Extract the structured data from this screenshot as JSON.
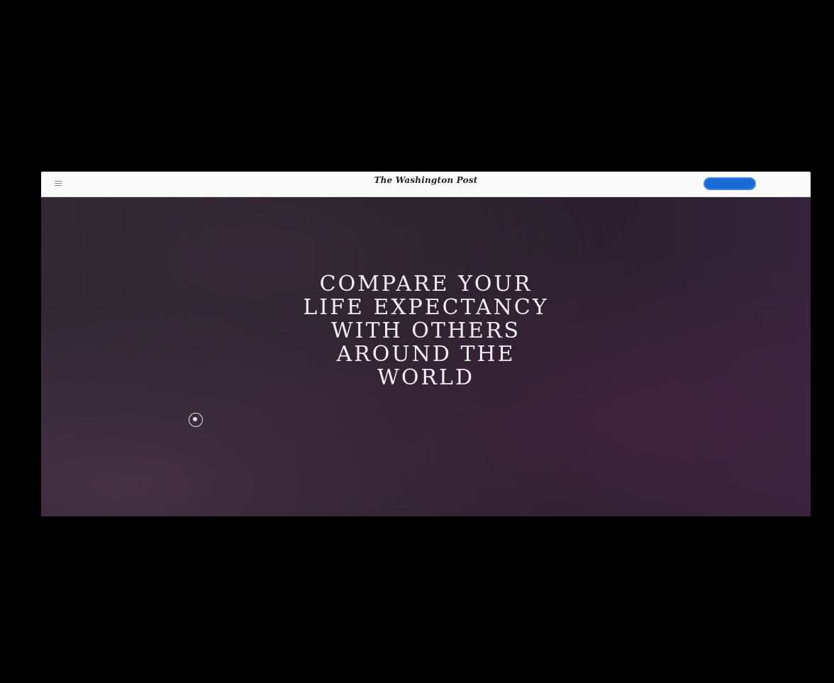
{
  "header": {
    "logo_text": "The Washington Post",
    "logo_tagline": "",
    "subscribe_label": "",
    "signin_label": ""
  },
  "article": {
    "kicker_label": "",
    "kicker_text": "",
    "headline_lines": [
      "COMPARE YOUR",
      "LIFE EXPECTANCY",
      "WITH OTHERS",
      "AROUND THE",
      "WORLD"
    ],
    "byline": "",
    "date": ""
  },
  "widget": {
    "icon": "play-circle-icon",
    "text": ""
  },
  "colors": {
    "page_background": "#000000",
    "header_background": "#fafafa",
    "subscribe_button": "#1a6bd6",
    "hero_background": "#2a2230",
    "headline_text": "#f2eff2"
  }
}
